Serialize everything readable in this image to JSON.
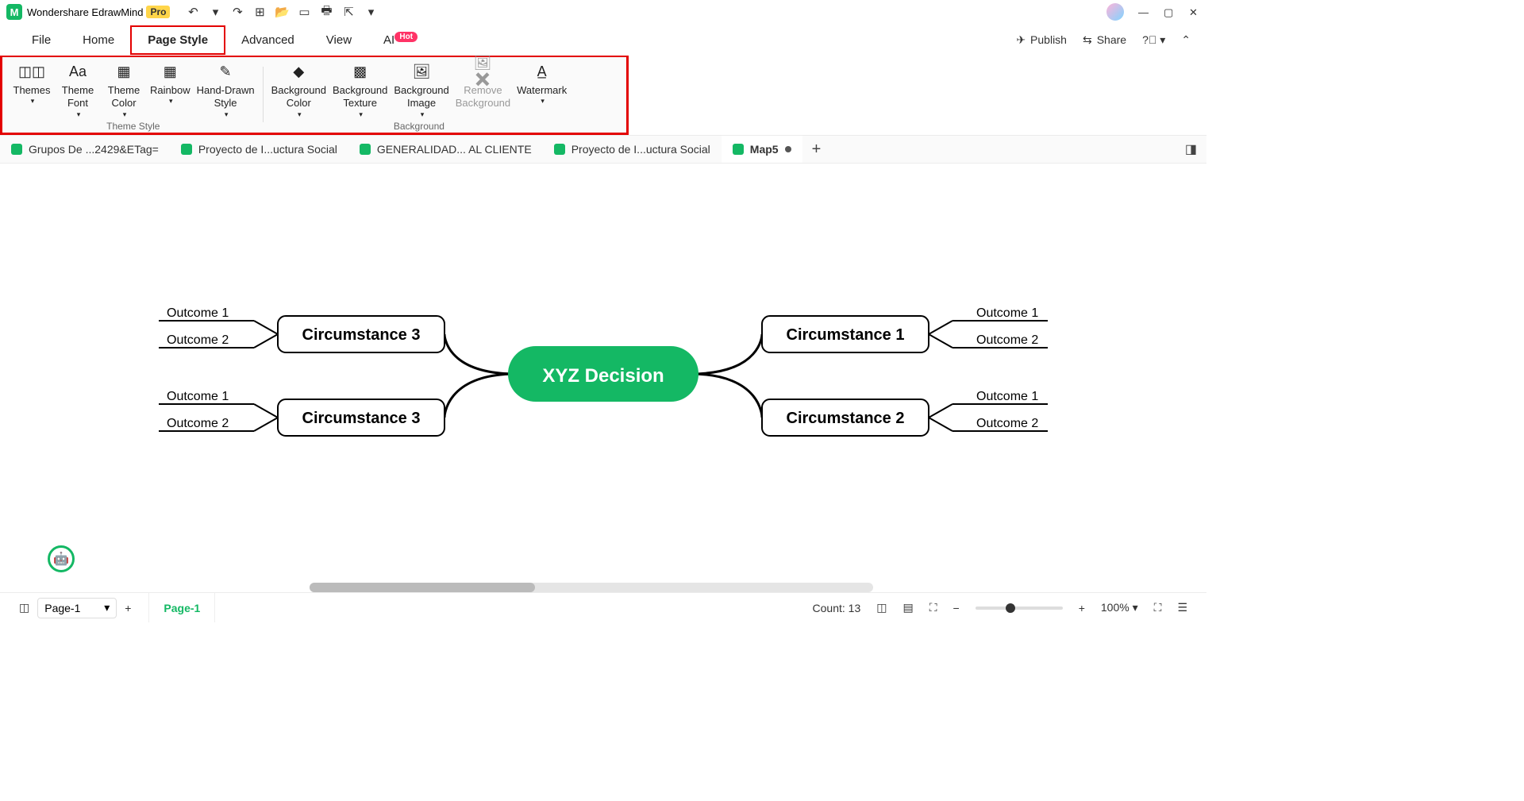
{
  "app": {
    "name": "Wondershare EdrawMind",
    "pro": "Pro"
  },
  "qat": {
    "more": "▾"
  },
  "window": {
    "min": "—",
    "max": "▢",
    "close": "✕"
  },
  "menu": {
    "items": [
      "File",
      "Home",
      "Page Style",
      "Advanced",
      "View",
      "AI"
    ],
    "active_index": 2,
    "ai_badge": "Hot",
    "publish": "Publish",
    "share": "Share"
  },
  "ribbon": {
    "groups": [
      {
        "label": "Theme Style",
        "buttons": [
          {
            "key": "themes",
            "label": "Themes",
            "dropdown": true
          },
          {
            "key": "theme-font",
            "label": "Theme\nFont",
            "dropdown": true
          },
          {
            "key": "theme-color",
            "label": "Theme\nColor",
            "dropdown": true
          },
          {
            "key": "rainbow",
            "label": "Rainbow",
            "dropdown": true
          },
          {
            "key": "hand-drawn",
            "label": "Hand-Drawn\nStyle",
            "dropdown": true
          }
        ]
      },
      {
        "label": "Background",
        "buttons": [
          {
            "key": "bg-color",
            "label": "Background\nColor",
            "dropdown": true
          },
          {
            "key": "bg-texture",
            "label": "Background\nTexture",
            "dropdown": true
          },
          {
            "key": "bg-image",
            "label": "Background\nImage",
            "dropdown": true
          },
          {
            "key": "remove-bg",
            "label": "Remove\nBackground",
            "disabled": true
          },
          {
            "key": "watermark",
            "label": "Watermark",
            "dropdown": true
          }
        ]
      }
    ]
  },
  "doc_tabs": {
    "items": [
      {
        "label": "Grupos De ...2429&ETag="
      },
      {
        "label": "Proyecto de I...uctura Social"
      },
      {
        "label": "GENERALIDAD... AL CLIENTE"
      },
      {
        "label": "Proyecto de I...uctura Social"
      },
      {
        "label": "Map5",
        "active": true,
        "dirty": true
      }
    ]
  },
  "mindmap": {
    "root": "XYZ Decision",
    "left_branches": [
      {
        "title": "Circumstance 3",
        "outcomes": [
          "Outcome 1",
          "Outcome 2"
        ]
      },
      {
        "title": "Circumstance 3",
        "outcomes": [
          "Outcome 1",
          "Outcome 2"
        ]
      }
    ],
    "right_branches": [
      {
        "title": "Circumstance 1",
        "outcomes": [
          "Outcome 1",
          "Outcome 2"
        ]
      },
      {
        "title": "Circumstance 2",
        "outcomes": [
          "Outcome 1",
          "Outcome 2"
        ]
      }
    ]
  },
  "status": {
    "page_select": "Page-1",
    "page_tab": "Page-1",
    "count_label": "Count:",
    "count": 13,
    "zoom": "100%"
  }
}
